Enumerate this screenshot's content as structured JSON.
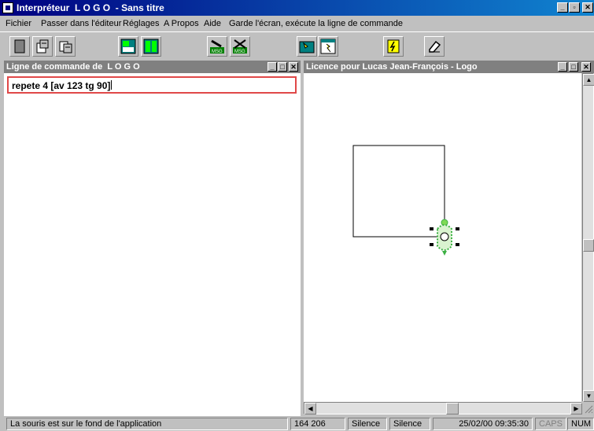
{
  "window": {
    "title": "Interpréteur  L O G O  - Sans titre",
    "minimize_label": "_",
    "maximize_label": "▫",
    "close_label": "✕"
  },
  "menu": {
    "items": [
      {
        "label": "Fichier"
      },
      {
        "label": "Passer dans l'éditeur"
      },
      {
        "label": "Réglages"
      },
      {
        "label": "A Propos"
      },
      {
        "label": "Aide"
      },
      {
        "label": "Garde l'écran, exécute la ligne de commande"
      }
    ]
  },
  "toolbar": {
    "icons": [
      "new-file-icon",
      "open-file-icon",
      "save-file-icon",
      "tile-horizontal-icon",
      "tile-vertical-icon",
      "message-on-icon",
      "message-off-icon",
      "run-canvas-icon",
      "run-step-icon",
      "execute-lightning-icon",
      "eraser-icon"
    ]
  },
  "command_panel": {
    "title": "Ligne de commande de  L O G O",
    "input_value": "repete 4 [av 123 tg 90]"
  },
  "canvas_panel": {
    "title": "Licence pour Lucas Jean-François - Logo",
    "drawing": {
      "command": "repete 4 [av 123 tg 90]",
      "side_length": 123,
      "turn_angle": 90,
      "repetitions": 4,
      "line_color": "#000000",
      "turtle_color": "#3cb043"
    }
  },
  "status": {
    "message": "La souris est sur le fond de l'application",
    "coordinates": "164 206",
    "sound1": "Silence",
    "sound2": "Silence",
    "datetime": "25/02/00 09:35:30",
    "caps": "CAPS",
    "num": "NUM"
  }
}
